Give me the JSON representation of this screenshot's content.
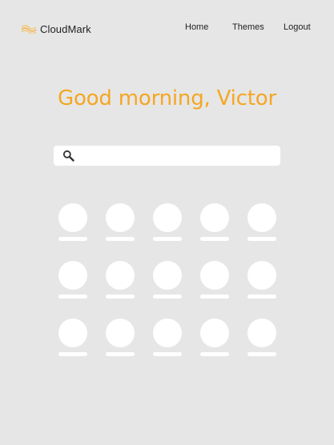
{
  "header": {
    "brand_name": "CloudMark",
    "logo_icon": "wave-logo-icon",
    "accent_color": "#f5a623",
    "nav": {
      "home": "Home",
      "themes": "Themes",
      "logout": "Logout"
    }
  },
  "main": {
    "greeting": "Good morning, Victor",
    "search": {
      "icon": "search-icon",
      "value": "",
      "placeholder": ""
    },
    "bookmarks": {
      "rows": 3,
      "columns": 5,
      "tiles": [
        {
          "label": ""
        },
        {
          "label": ""
        },
        {
          "label": ""
        },
        {
          "label": ""
        },
        {
          "label": ""
        },
        {
          "label": ""
        },
        {
          "label": ""
        },
        {
          "label": ""
        },
        {
          "label": ""
        },
        {
          "label": ""
        },
        {
          "label": ""
        },
        {
          "label": ""
        },
        {
          "label": ""
        },
        {
          "label": ""
        },
        {
          "label": ""
        }
      ]
    }
  }
}
